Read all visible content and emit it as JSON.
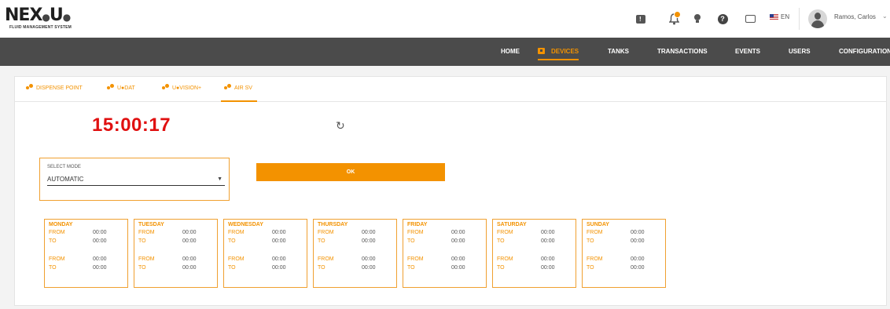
{
  "header": {
    "logo_text": "NEX",
    "logo_text2": "U",
    "logo_subtitle": "FLUID MANAGEMENT SYSTEM",
    "language": "EN",
    "user_name": "Ramos, Carlos",
    "icons": [
      "chat-icon",
      "bell-icon",
      "bulb-icon",
      "help-icon",
      "keyboard-icon",
      "flag-icon",
      "avatar-icon"
    ]
  },
  "nav": {
    "items": [
      {
        "label": "HOME",
        "active": false
      },
      {
        "label": "DEVICES",
        "active": true
      },
      {
        "label": "TANKS",
        "active": false
      },
      {
        "label": "TRANSACTIONS",
        "active": false
      },
      {
        "label": "EVENTS",
        "active": false
      },
      {
        "label": "USERS",
        "active": false
      },
      {
        "label": "CONFIGURATION",
        "active": false
      }
    ]
  },
  "tabs": [
    {
      "label": "DISPENSE POINT",
      "active": false
    },
    {
      "label": "U●DAT",
      "active": false
    },
    {
      "label": "U●VISION+",
      "active": false
    },
    {
      "label": "AIR SV",
      "active": true
    }
  ],
  "clock": "15:00:17",
  "mode": {
    "label": "SELECT MODE",
    "value": "AUTOMATIC"
  },
  "ok_label": "OK",
  "schedule": {
    "from_label": "FROM",
    "to_label": "TO",
    "days": [
      {
        "name": "MONDAY",
        "slots": [
          {
            "from": "00:00",
            "to": "00:00"
          },
          {
            "from": "00:00",
            "to": "00:00"
          }
        ]
      },
      {
        "name": "TUESDAY",
        "slots": [
          {
            "from": "00:00",
            "to": "00:00"
          },
          {
            "from": "00:00",
            "to": "00:00"
          }
        ]
      },
      {
        "name": "WEDNESDAY",
        "slots": [
          {
            "from": "00:00",
            "to": "00:00"
          },
          {
            "from": "00:00",
            "to": "00:00"
          }
        ]
      },
      {
        "name": "THURSDAY",
        "slots": [
          {
            "from": "00:00",
            "to": "00:00"
          },
          {
            "from": "00:00",
            "to": "00:00"
          }
        ]
      },
      {
        "name": "FRIDAY",
        "slots": [
          {
            "from": "00:00",
            "to": "00:00"
          },
          {
            "from": "00:00",
            "to": "00:00"
          }
        ]
      },
      {
        "name": "SATURDAY",
        "slots": [
          {
            "from": "00:00",
            "to": "00:00"
          },
          {
            "from": "00:00",
            "to": "00:00"
          }
        ]
      },
      {
        "name": "SUNDAY",
        "slots": [
          {
            "from": "00:00",
            "to": "00:00"
          },
          {
            "from": "00:00",
            "to": "00:00"
          }
        ]
      }
    ]
  },
  "colors": {
    "accent": "#f39200",
    "nav_bg": "#4b4b4b",
    "clock": "#e01010"
  }
}
